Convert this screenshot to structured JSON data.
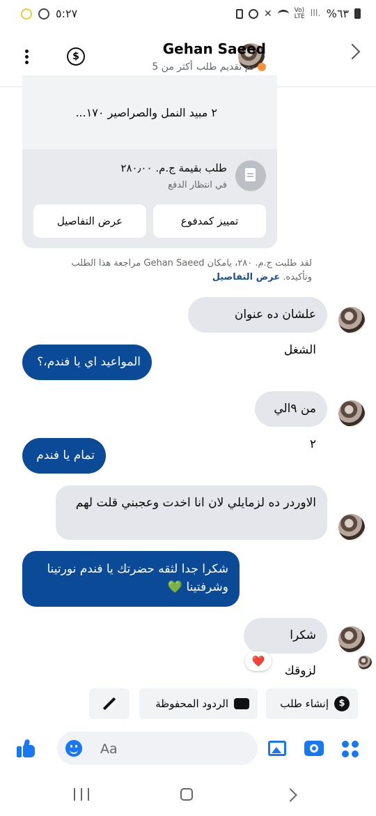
{
  "status_bar": {
    "time": "٥:٢٧",
    "battery": "%٦٣"
  },
  "header": {
    "name": "Gehan Saeed",
    "status": "تم تقديم طلب",
    "recent": "أكثر من 5"
  },
  "order_card": {
    "item": "٢ مبيد النمل والصراصير ١٧٠...",
    "order_title": "طلب بقيمة ج.م. ٢٨٠٫٠٠",
    "order_status": "في انتظار الدفع",
    "mark_paid_label": "تمييز كمدفوع",
    "view_details_label": "عرض التفاصيل"
  },
  "system_message": {
    "text": "لقد طلبت ج.م. ٢٨٠، يامكان Gehan Saeed مراجعة هذا الطلب وتأكيده.",
    "link": "عرض التفاصيل"
  },
  "messages": [
    {
      "from": "them",
      "text": "علشان ده عنوان الشغل"
    },
    {
      "from": "me",
      "text": "المواعيد اي يا فندم،؟"
    },
    {
      "from": "them",
      "text": "من ٩الي ٢"
    },
    {
      "from": "me",
      "text": "تمام يا فندم"
    },
    {
      "from": "them",
      "text": "الاوردر ده لزمايلي لان انا اخدت وعجبني  قلت لهم"
    },
    {
      "from": "me",
      "text": "شكرا جدا لثقه حضرتك يا فندم نورتينا وشرفتينا 💚"
    },
    {
      "from": "them",
      "text": "شكرا لزوقك"
    }
  ],
  "reaction": "❤️",
  "quick_actions": {
    "create_order": "إنشاء طلب",
    "saved_replies": "الردود المحفوظة"
  },
  "composer": {
    "placeholder": "Aa"
  },
  "colors": {
    "accent": "#1877f2",
    "outgoing_bubble": "#0b4a97",
    "incoming_bubble": "#e4e6eb",
    "status_dot": "#f7923a"
  }
}
